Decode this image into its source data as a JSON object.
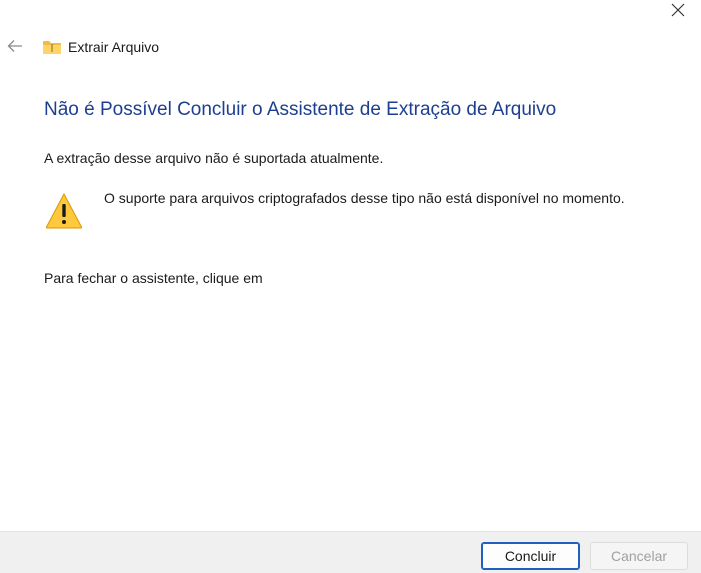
{
  "window": {
    "title": "Extrair Arquivo",
    "close_icon": "close-icon",
    "back_icon": "back-arrow-icon",
    "app_icon": "zip-folder-icon"
  },
  "content": {
    "heading": "Não é Possível Concluir o Assistente de Extração de Arquivo",
    "description": "A extração desse arquivo não é suportada atualmente.",
    "warning_icon": "warning-icon",
    "warning_text": "O suporte para arquivos criptografados desse tipo não está disponível no momento.",
    "close_hint": "Para fechar o assistente, clique em"
  },
  "footer": {
    "ok_label": "Concluir",
    "cancel_label": "Cancelar",
    "cancel_disabled": true
  },
  "colors": {
    "heading": "#1d3f8f",
    "footer_bg": "#f0f0f0",
    "primary_border": "#1f5fbf",
    "warning_fill": "#ffc83d"
  }
}
